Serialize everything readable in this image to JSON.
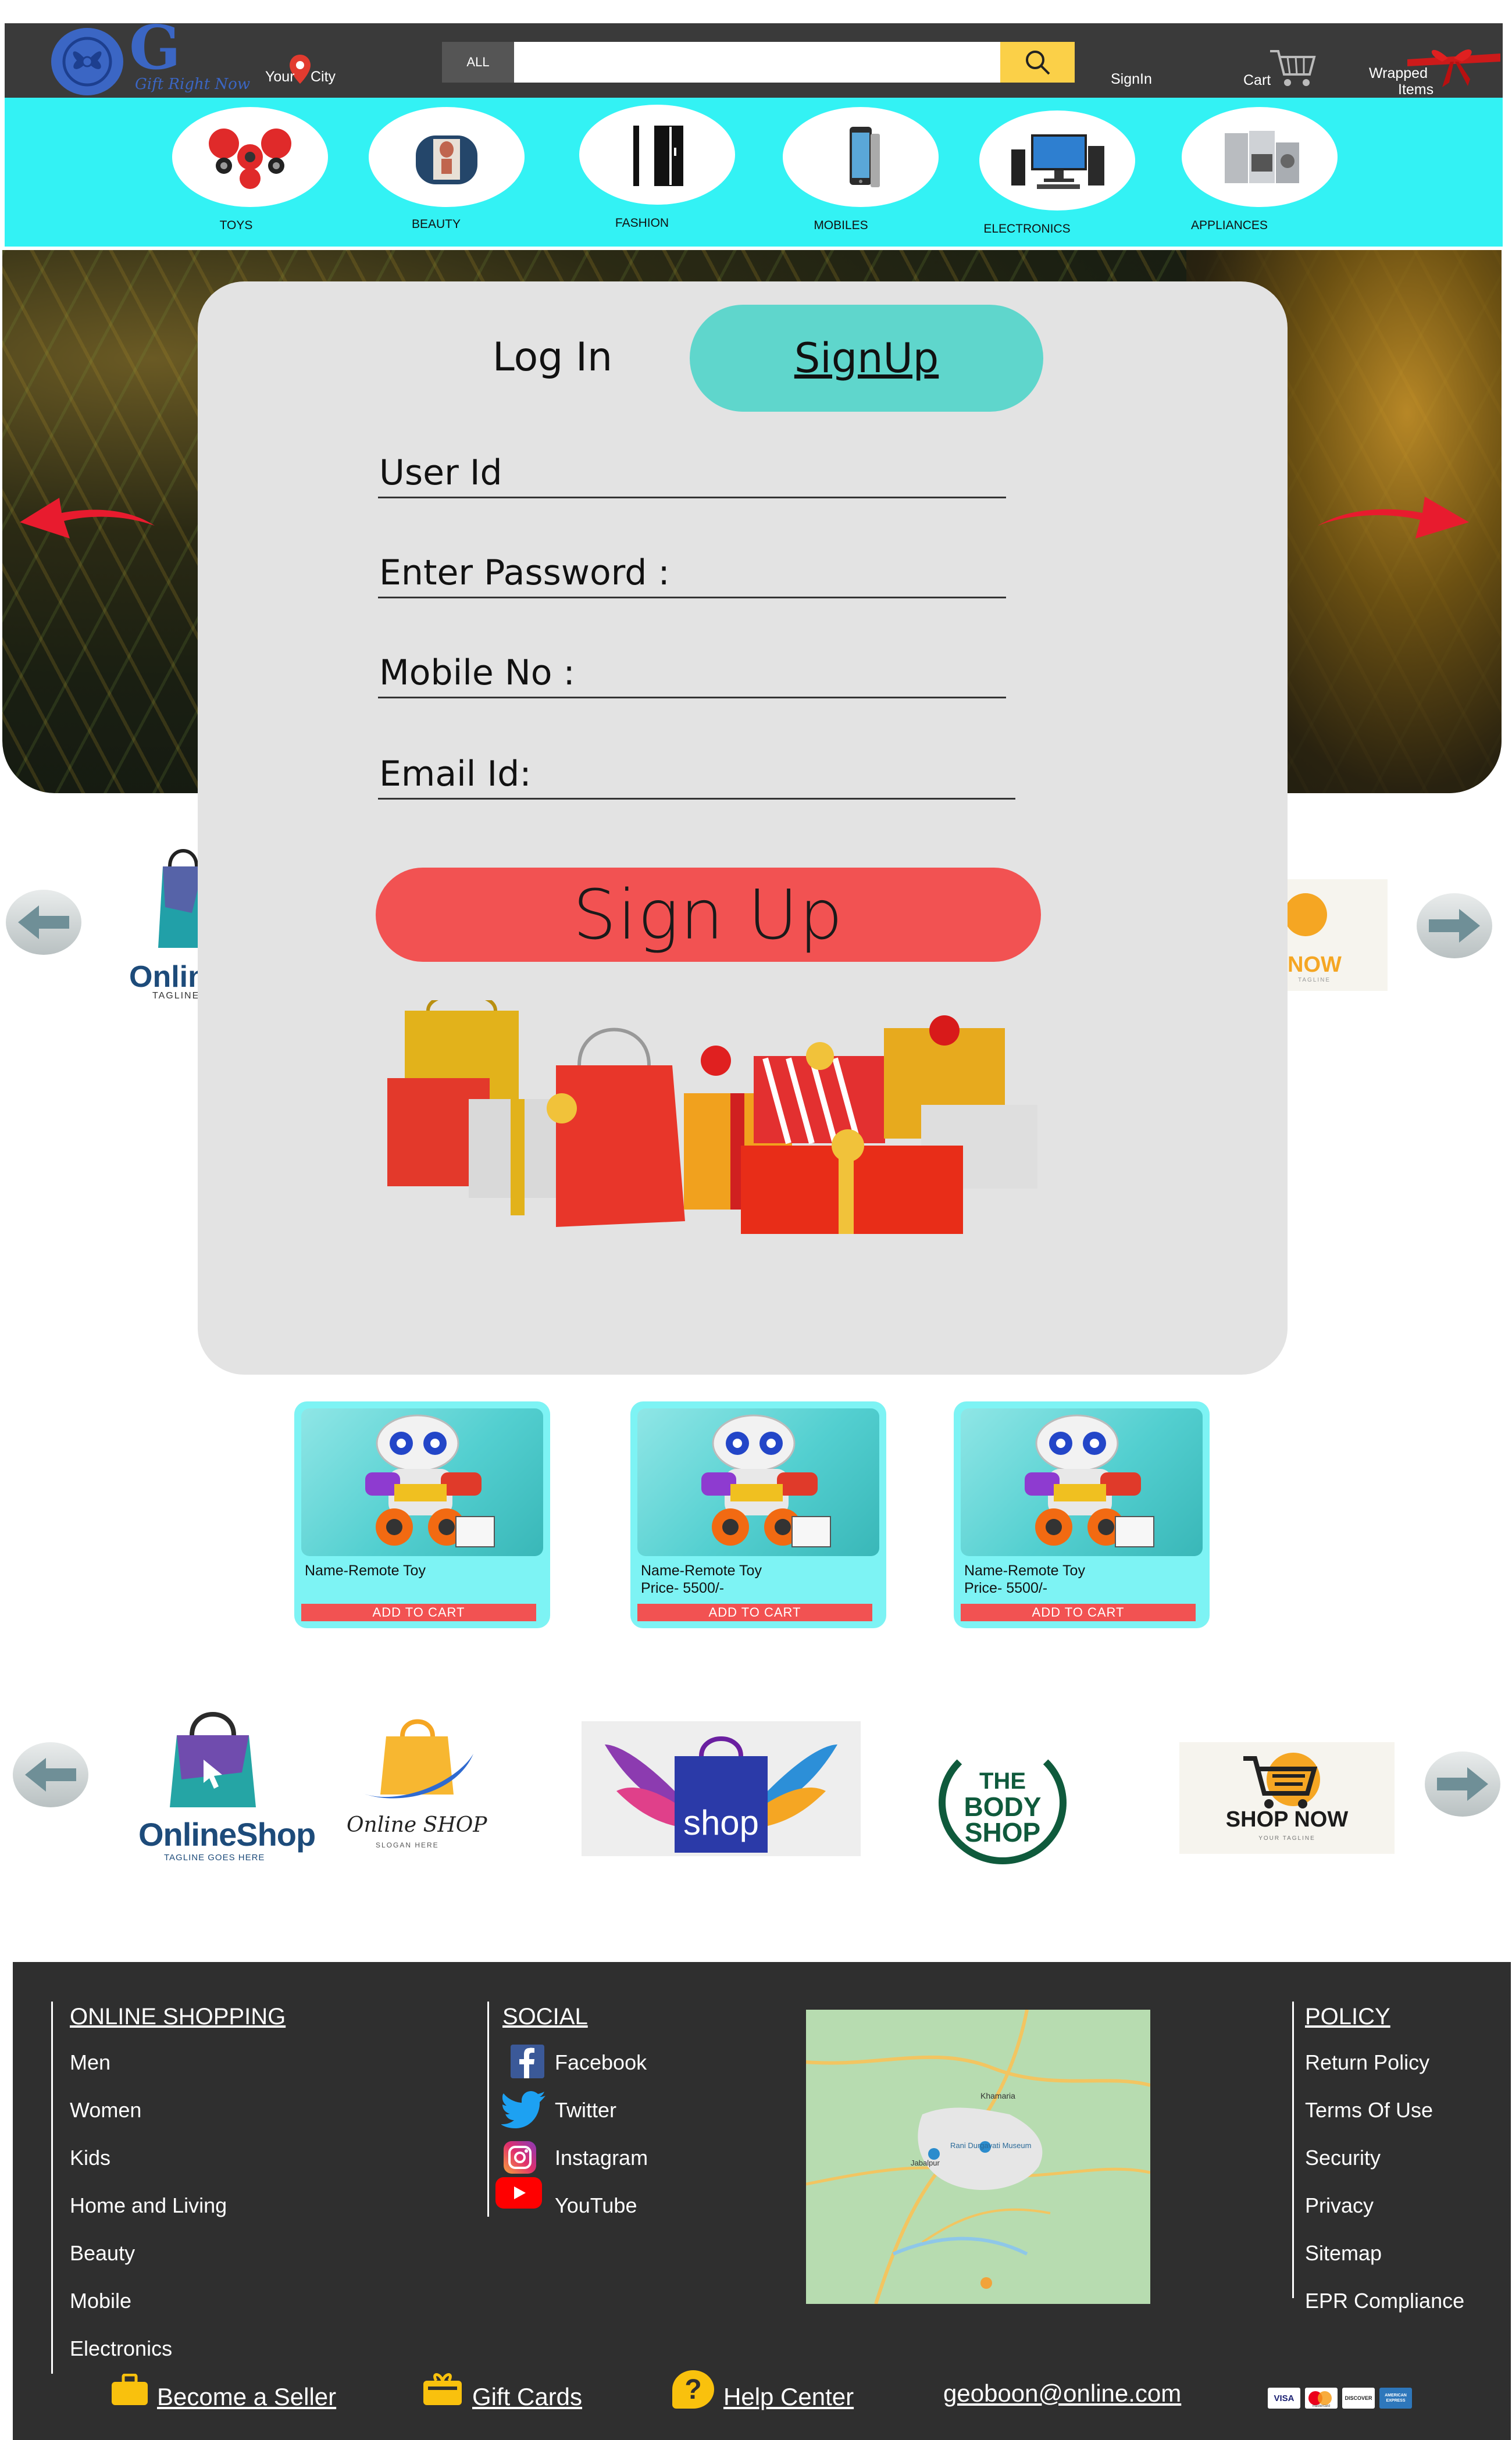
{
  "header": {
    "logo_letter": "G",
    "logo_tagline": "Gift Right Now",
    "location_label_1": "Your",
    "location_label_2": "City",
    "search_category": "ALL",
    "search_value": "",
    "signin_label": "SignIn",
    "cart_label": "Cart",
    "wrapped_label_1": "Wrapped",
    "wrapped_label_2": "Items"
  },
  "categories": [
    {
      "label": "TOYS",
      "icon": "fidget-spinner-icon"
    },
    {
      "label": "BEAUTY",
      "icon": "beauty-icon"
    },
    {
      "label": "FASHION",
      "icon": "wardrobe-icon"
    },
    {
      "label": "MOBILES",
      "icon": "phone-icon"
    },
    {
      "label": "ELECTRONICS",
      "icon": "computer-icon"
    },
    {
      "label": "APPLIANCES",
      "icon": "appliances-icon"
    }
  ],
  "auth": {
    "tab_login": "Log In",
    "tab_signup": "SignUp",
    "user_id_placeholder": "User Id",
    "password_placeholder": "Enter Password :",
    "mobile_placeholder": "Mobile No :",
    "email_placeholder": "Email Id:",
    "submit_label": "Sign Up"
  },
  "top_brands_partial": {
    "left_text": "Onlin",
    "left_tagline": "TAGLINE",
    "right_text": "NOW",
    "right_tagline": "TAGLINE"
  },
  "products": [
    {
      "name": "Name-Remote Toy",
      "price": "",
      "button": "ADD TO CART"
    },
    {
      "name": "Name-Remote Toy",
      "price": "Price- 5500/-",
      "button": "ADD TO CART"
    },
    {
      "name": "Name-Remote Toy",
      "price": "Price- 5500/-",
      "button": "ADD TO CART"
    }
  ],
  "brands": {
    "brand1_name": "OnlineShop",
    "brand1_tagline": "TAGLINE GOES HERE",
    "brand2_name": "Online SHOP",
    "brand2_tagline": "SLOGAN HERE",
    "brand3_name": "shop",
    "brand4_line1": "THE",
    "brand4_line2": "BODY",
    "brand4_line3": "SHOP",
    "brand5_name": "SHOP NOW",
    "brand5_tagline": "YOUR TAGLINE"
  },
  "footer": {
    "online_shopping_title": "ONLINE SHOPPING",
    "online_shopping_items": [
      "Men",
      "Women",
      "Kids",
      "Home and Living",
      "Beauty",
      "Mobile",
      "Electronics"
    ],
    "social_title": "SOCIAL",
    "social_items": [
      "Facebook",
      "Twitter",
      "Instagram",
      "YouTube"
    ],
    "policy_title": "POLICY",
    "policy_items": [
      "Return Policy",
      "Terms Of Use",
      "Security",
      "Privacy",
      "Sitemap",
      "EPR Compliance"
    ],
    "become_seller": "Become a Seller",
    "gift_cards": "Gift Cards",
    "help_center": "Help Center",
    "email": "geoboon@online.com",
    "payment_labels": [
      "VISA",
      "mastercard",
      "DISCOVER",
      "AMERICAN EXPRESS"
    ],
    "map_labels": [
      "Khamaria",
      "Rani Durgavati Museum",
      "Jabalpur"
    ]
  },
  "colors": {
    "header_bg": "#3a3a3a",
    "category_bg": "#33f2f4",
    "signup_tab": "#5fd6cc",
    "signup_button": "#f25252",
    "card_bg": "#e3e3e3",
    "product_bg": "#7df3f4",
    "footer_bg": "#2f2f2f",
    "search_button": "#fbd048",
    "logo_blue": "#3b66c4"
  }
}
